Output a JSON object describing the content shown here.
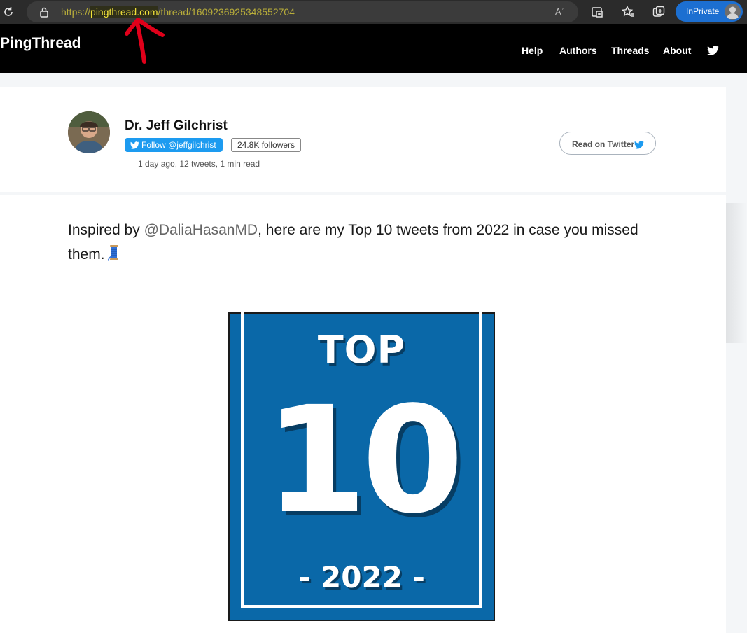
{
  "browser": {
    "url_prefix": "https://",
    "url_domain": "pingthread.com",
    "url_path": "/thread/1609236925348552704",
    "read_aloud": "Aʾ",
    "inprivate_label": "InPrivate"
  },
  "site": {
    "brand": "PingThread",
    "nav": [
      {
        "label": "Help"
      },
      {
        "label": "Authors"
      },
      {
        "label": "Threads"
      },
      {
        "label": "About"
      }
    ]
  },
  "author": {
    "name": "Dr. Jeff Gilchrist",
    "follow_label": "Follow @jeffgilchrist",
    "followers": "24.8K followers",
    "meta": "1 day ago, 12 tweets, 1 min read",
    "read_on_twitter": "Read on Twitter"
  },
  "tweet": {
    "text_before": "Inspired by ",
    "mention": "@DaliaHasanMD",
    "text_after": ", here are my Top 10 tweets from 2022 in case you missed them.",
    "emoji_name": "thread-spool-icon"
  },
  "image": {
    "top": "TOP",
    "number": "10",
    "year": "- 2022 -"
  },
  "colors": {
    "header_bg": "#000000",
    "twitter_blue": "#1d9bf0",
    "image_blue": "#0a68a8",
    "annotation_red": "#e0001a"
  }
}
